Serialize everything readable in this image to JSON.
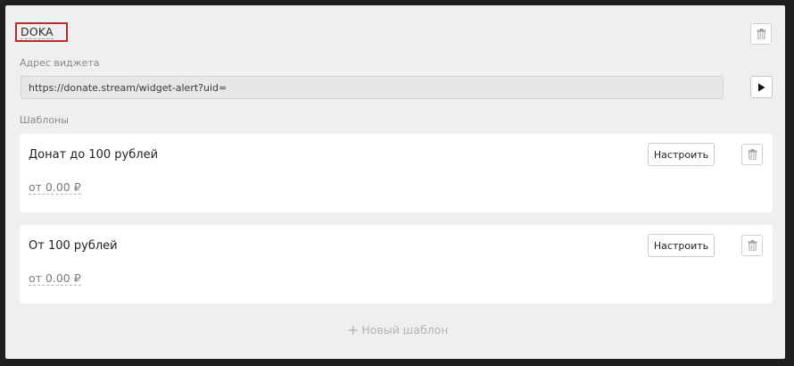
{
  "widget": {
    "name": "DOKA",
    "address_label": "Адрес виджета",
    "url": "https://donate.stream/widget-alert?uid=",
    "templates_label": "Шаблоны"
  },
  "templates": [
    {
      "title": "Донат до 100 рублей",
      "amount": "от 0.00 ₽",
      "configure_label": "Настроить"
    },
    {
      "title": "От 100 рублей",
      "amount": "от 0.00 ₽",
      "configure_label": "Настроить"
    }
  ],
  "new_template": {
    "plus": "+",
    "label": "Новый шаблон"
  },
  "icons": {
    "delete": "trash-icon",
    "play": "play-icon"
  }
}
